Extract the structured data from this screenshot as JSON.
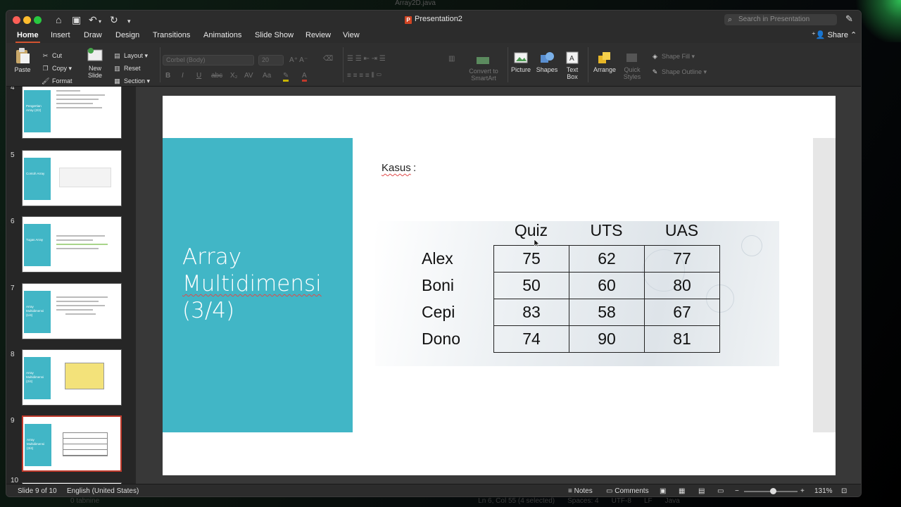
{
  "background_title": "Array2D.java",
  "background_status": [
    "0 tabnine",
    "Ln 6, Col 55 (4 selected)",
    "Spaces: 4",
    "UTF-8",
    "LF",
    "Java"
  ],
  "window": {
    "title": "Presentation2",
    "search_placeholder": "Search in Presentation"
  },
  "tabs": [
    "Home",
    "Insert",
    "Draw",
    "Design",
    "Transitions",
    "Animations",
    "Slide Show",
    "Review",
    "View"
  ],
  "active_tab": "Home",
  "share_label": "Share",
  "ribbon": {
    "paste": "Paste",
    "cut": "Cut",
    "copy": "Copy",
    "format": "Format",
    "new_slide": "New Slide",
    "layout": "Layout",
    "reset": "Reset",
    "section": "Section",
    "font_name": "Corbel (Body)",
    "font_size": "20",
    "convert_smartart": "Convert to SmartArt",
    "picture": "Picture",
    "shapes": "Shapes",
    "text_box": "Text Box",
    "arrange": "Arrange",
    "quick_styles": "Quick Styles",
    "shape_fill": "Shape Fill",
    "shape_outline": "Shape Outline"
  },
  "thumbnails": [
    {
      "num": "4",
      "title": "Pengertian Array (2/2)"
    },
    {
      "num": "5",
      "title": "Contoh Array"
    },
    {
      "num": "6",
      "title": "Tugas Array"
    },
    {
      "num": "7",
      "title": "Array Multidimensi (1/4)"
    },
    {
      "num": "8",
      "title": "Array Multidimensi (2/4)"
    },
    {
      "num": "9",
      "title": "Array Multidimensi (3/4)"
    },
    {
      "num": "10",
      "title": ""
    }
  ],
  "slide": {
    "title_line1": "Array",
    "title_line2": "Multidimensi",
    "title_line3": "(3/4)",
    "kasus": "Kasus",
    "kasus_colon": ":",
    "columns": [
      "Quiz",
      "UTS",
      "UAS"
    ],
    "rows": [
      {
        "name": "Alex",
        "values": [
          "75",
          "62",
          "77"
        ]
      },
      {
        "name": "Boni",
        "values": [
          "50",
          "60",
          "80"
        ]
      },
      {
        "name": "Cepi",
        "values": [
          "83",
          "58",
          "67"
        ]
      },
      {
        "name": "Dono",
        "values": [
          "74",
          "90",
          "81"
        ]
      }
    ]
  },
  "status": {
    "slide_info": "Slide 9 of 10",
    "language": "English (United States)",
    "notes": "Notes",
    "comments": "Comments",
    "zoom": "131%"
  },
  "colors": {
    "accent_teal": "#41b6c6",
    "tab_underline": "#d35230",
    "selected_thumb": "#c0392b"
  }
}
